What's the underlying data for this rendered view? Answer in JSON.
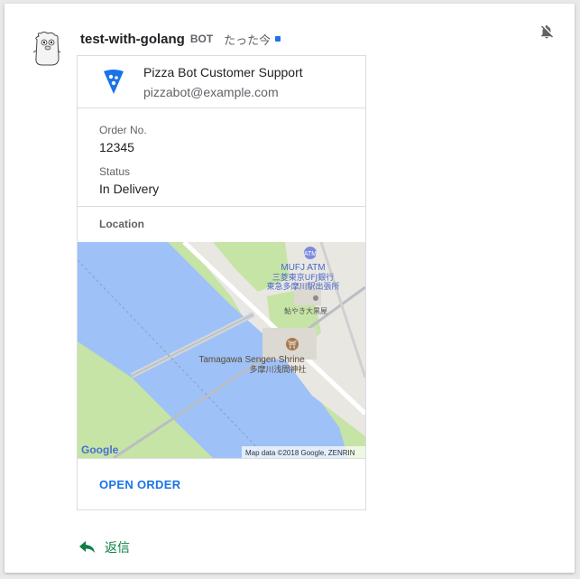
{
  "message": {
    "sender": "test-with-golang",
    "bot_tag": "BOT",
    "timestamp": "たった今"
  },
  "card": {
    "title": "Pizza Bot Customer Support",
    "subtitle": "pizzabot@example.com",
    "fields": [
      {
        "label": "Order No.",
        "value": "12345"
      },
      {
        "label": "Status",
        "value": "In Delivery"
      }
    ],
    "location_label": "Location",
    "map": {
      "poi_atm_title": "MUFJ ATM",
      "poi_atm_sub1": "三菱東京UFJ銀行",
      "poi_atm_sub2": "東急多摩川駅出張所",
      "poi_shop": "鮎やき大黒屋",
      "poi_shrine_title": "Tamagawa Sengen Shrine",
      "poi_shrine_sub": "多摩川浅間神社",
      "logo": "Google",
      "attribution": "Map data ©2018 Google, ZENRIN"
    },
    "action_label": "OPEN ORDER"
  },
  "reply_label": "返信",
  "icons": {
    "mute": "bell-off-icon",
    "reply": "reply-arrow-icon",
    "logo": "pizza-slice-icon"
  },
  "colors": {
    "accent": "#1a73e8",
    "reply": "#0b8043",
    "water": "#9ec1f7",
    "park": "#c6e4a5"
  }
}
